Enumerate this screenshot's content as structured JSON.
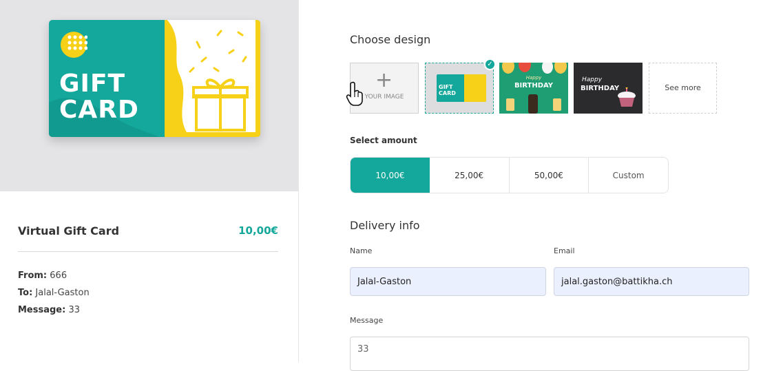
{
  "preview": {
    "card_line1": "GIFT",
    "card_line2": "CARD"
  },
  "summary": {
    "title": "Virtual Gift Card",
    "price": "10,00€",
    "from_label": "From:",
    "from_value": "666",
    "to_label": "To:",
    "to_value": "Jalal-Gaston",
    "message_label": "Message:",
    "message_value": "33"
  },
  "design": {
    "heading": "Choose design",
    "upload_label": "YOUR IMAGE",
    "gift_tile_line1": "GIFT",
    "gift_tile_line2": "CARD",
    "bday1_script": "Happy",
    "bday1_text": "BIRTHDAY",
    "bday2_script": "Happy",
    "bday2_text": "BIRTHDAY",
    "see_more": "See more",
    "selected_check": "✓"
  },
  "amount": {
    "heading": "Select amount",
    "options": [
      "10,00€",
      "25,00€",
      "50,00€",
      "Custom"
    ],
    "selected": "10,00€"
  },
  "delivery": {
    "heading": "Delivery info",
    "name_label": "Name",
    "name_value": "Jalal-Gaston",
    "email_label": "Email",
    "email_value": "jalal.gaston@battikha.ch",
    "message_label": "Message",
    "message_value": "33"
  },
  "colors": {
    "accent": "#14a79b",
    "card_yellow": "#f7d117"
  }
}
